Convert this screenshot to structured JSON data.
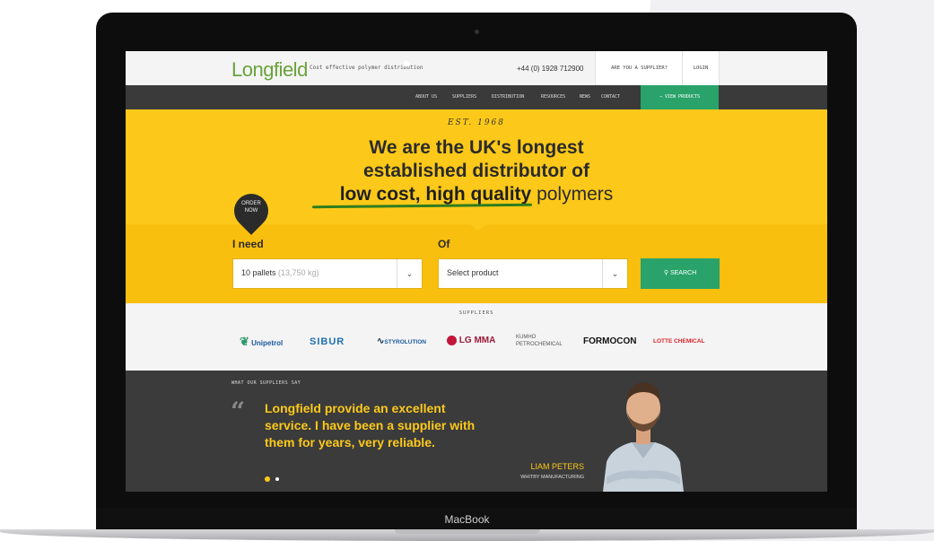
{
  "laptop": {
    "brand": "MacBook"
  },
  "site": {
    "logo": "Longfield",
    "tagline": "Cost effective polymer distribution",
    "phone": "+44 (0) 1928 712900",
    "supplier_link": "ARE YOU A SUPPLIER?",
    "login": "LOGIN"
  },
  "nav": {
    "items": [
      "ABOUT US",
      "SUPPLIERS",
      "DISTRIBUTION",
      "RESOURCES",
      "NEWS",
      "CONTACT"
    ],
    "cta": "→ VIEW PRODUCTS"
  },
  "hero": {
    "est": "EST. 1968",
    "line1": "We are the UK's longest",
    "line2": "established distributor of",
    "line3_bold": "low cost, high quality",
    "line3_rest": " polymers",
    "order_badge_1": "ORDER",
    "order_badge_2": "NOW"
  },
  "order_form": {
    "need_label": "I need",
    "of_label": "Of",
    "quantity_value": "10 pallets",
    "quantity_hint": " (13,750 kg)",
    "product_placeholder": "Select product",
    "search_label": "SEARCH"
  },
  "suppliers": {
    "title": "SUPPLIERS",
    "logos": [
      "Unipetrol",
      "SIBUR",
      "STYROLUTION",
      "LG MMA",
      "KUMHO PETROCHEMICAL",
      "FORMOCON",
      "LOTTE CHEMICAL"
    ]
  },
  "testimonial": {
    "heading": "WHAT OUR SUPPLIERS SAY",
    "quote_line1": "Longfield provide an excellent",
    "quote_line2": "service. I have been a supplier with",
    "quote_line3": "them for years, very reliable.",
    "name": "LIAM PETERS",
    "company": "WHITBY MANUFACTURING"
  },
  "colors": {
    "yellow": "#fcc91a",
    "green": "#29a36a",
    "dark": "#3b3b3b",
    "logo_green": "#6aa23a"
  }
}
